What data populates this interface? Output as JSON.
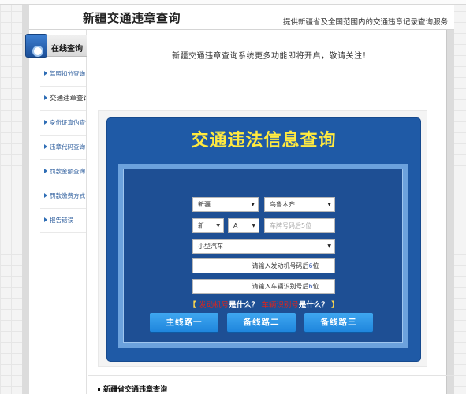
{
  "header": {
    "title": "新疆交通违章查询",
    "subtitle": "提供新疆省及全国范围内的交通违章记录查询服务"
  },
  "sidebar": {
    "heading": "在线查询",
    "items": [
      {
        "label": "驾照扣分查询"
      },
      {
        "label": "交通违章查询"
      },
      {
        "label": "身份证真伪查询"
      },
      {
        "label": "违章代码查询"
      },
      {
        "label": "罚款金额查询"
      },
      {
        "label": "罚款缴费方式"
      },
      {
        "label": "报告错误"
      }
    ]
  },
  "notice": "新疆交通违章查询系统更多功能即将开启，敬请关注！",
  "query": {
    "title": "交通违法信息查询",
    "province": "新疆",
    "city": "乌鲁木齐",
    "plate_prefix": "新",
    "plate_letter": "A",
    "plate_placeholder": "车牌号码后5位",
    "vehicle_type": "小型汽车",
    "engine_field": {
      "pre": "请输入发动机号码后",
      "num": "6",
      "post": "位"
    },
    "vin_field": {
      "pre": "请输入车辆识别号后",
      "num": "6",
      "post": "位"
    },
    "help": {
      "open": "【",
      "q1_link": "发动机号",
      "q1_text": "是什么？",
      "q2_link": "车辆识别号",
      "q2_text": "是什么？",
      "close": "】"
    },
    "buttons": [
      "主线路一",
      "备线路二",
      "备线路三"
    ]
  },
  "footer": {
    "title": "新疆省交通违章查询"
  },
  "colors": {
    "query_bg": "#1f5aa6",
    "title_yellow": "#ffe93f",
    "button_blue": "#2a95e6",
    "help_red": "#e0241b"
  }
}
